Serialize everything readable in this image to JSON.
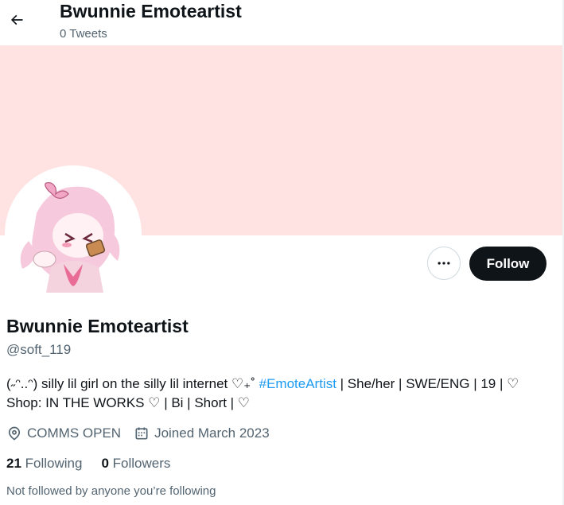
{
  "header": {
    "title": "Bwunnie Emoteartist",
    "tweet_count": "0 Tweets",
    "back_icon": "arrow-left-icon"
  },
  "colors": {
    "banner": "#ffe2e2",
    "follow_button_bg": "#0f1419",
    "hashtag": "#1d9bf0",
    "secondary_text": "#536471"
  },
  "profile": {
    "display_name": "Bwunnie Emoteartist",
    "handle": "@soft_119",
    "bio_part1": "(˶ᵔ..ᵔ) silly lil girl on the silly lil internet ♡₊˚ ",
    "bio_hashtag": "#EmoteArtist",
    "bio_part2": " | She/her | SWE/ENG |  19  | ♡ Shop: IN THE WORKS ♡ | Bi | Short  | ♡",
    "location": "COMMS OPEN",
    "location_icon": "location-pin-icon",
    "joined": "Joined March 2023",
    "joined_icon": "calendar-icon"
  },
  "actions": {
    "more_icon": "more-dots-icon",
    "follow_label": "Follow"
  },
  "stats": {
    "following_count": "21",
    "following_label": " Following",
    "followers_count": "0",
    "followers_label": " Followers"
  },
  "footer_note": "Not followed by anyone you’re following"
}
